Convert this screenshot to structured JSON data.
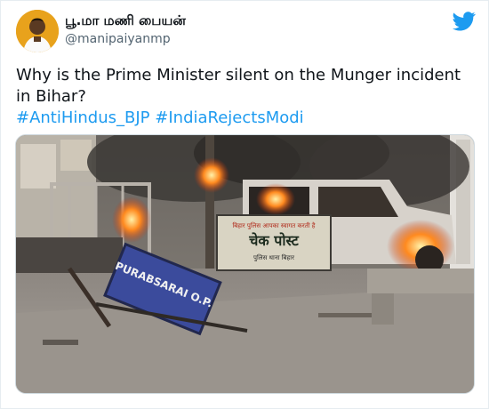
{
  "author": {
    "name": "பூ.மா மணி பையன்",
    "handle": "@manipaiyanmp"
  },
  "tweet": {
    "text": "Why is the Prime Minister silent on the Munger incident in Bihar?",
    "hashtags": [
      "#AntiHindus_BJP",
      "#IndiaRejectsModi"
    ]
  },
  "media": {
    "sign_text": "PURABSARAI O.P.",
    "booth_sign_title": "चेक पोस्ट",
    "booth_sign_line1": "बिहार पुलिस आपका स्वागत करती है",
    "booth_sign_line2": "पुलिस थाना बिहार"
  },
  "colors": {
    "link": "#1d9bf0",
    "twitter_blue": "#1d9bf0",
    "text": "#0f1419",
    "secondary": "#536471"
  },
  "icons": {
    "logo": "twitter-bird-icon"
  }
}
